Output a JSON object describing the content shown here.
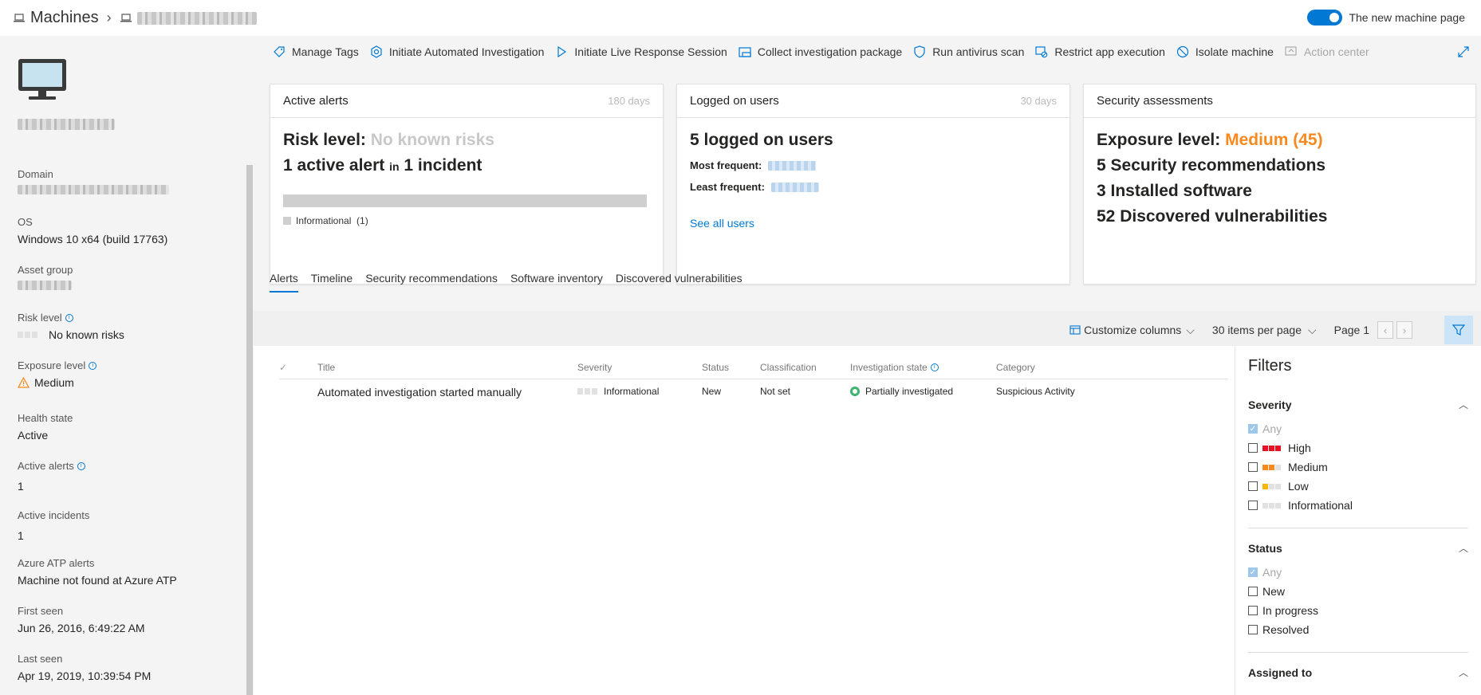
{
  "header": {
    "breadcrumb_root": "Machines",
    "toggle_label": "The new machine page"
  },
  "actions": [
    {
      "label": "Manage Tags",
      "icon": "tag-icon"
    },
    {
      "label": "Initiate Automated Investigation",
      "icon": "investigation-icon"
    },
    {
      "label": "Initiate Live Response Session",
      "icon": "play-icon"
    },
    {
      "label": "Collect investigation package",
      "icon": "package-icon"
    },
    {
      "label": "Run antivirus scan",
      "icon": "shield-icon"
    },
    {
      "label": "Restrict app execution",
      "icon": "restrict-icon"
    },
    {
      "label": "Isolate machine",
      "icon": "block-icon"
    },
    {
      "label": "Action center",
      "icon": "action-center-icon"
    }
  ],
  "sidebar": {
    "domain_label": "Domain",
    "os_label": "OS",
    "os_value": "Windows 10 x64 (build 17763)",
    "asset_group_label": "Asset group",
    "risk_label": "Risk level",
    "risk_value": "No known risks",
    "exposure_label": "Exposure level",
    "exposure_value": "Medium",
    "health_label": "Health state",
    "health_value": "Active",
    "alerts_label": "Active alerts",
    "alerts_value": "1",
    "incidents_label": "Active incidents",
    "incidents_value": "1",
    "atp_label": "Azure ATP alerts",
    "atp_value": "Machine not found at Azure ATP",
    "first_seen_label": "First seen",
    "first_seen_value": "Jun 26, 2016, 6:49:22 AM",
    "last_seen_label": "Last seen",
    "last_seen_value": "Apr 19, 2019, 10:39:54 PM"
  },
  "cards": {
    "alerts": {
      "title": "Active alerts",
      "days": "180 days",
      "risk_prefix": "Risk level: ",
      "risk_value": "No known risks",
      "alert_count": "1 active alert",
      "in_word": "in",
      "incident_count": "1 incident",
      "legend_label": "Informational",
      "legend_count": "(1)"
    },
    "users": {
      "title": "Logged on users",
      "days": "30 days",
      "count": "5 logged on users",
      "most_label": "Most frequent:",
      "least_label": "Least frequent:",
      "link": "See all users"
    },
    "security": {
      "title": "Security assessments",
      "exposure_prefix": "Exposure level: ",
      "exposure_value": "Medium (45)",
      "recommendations": "5 Security recommendations",
      "software": "3 Installed software",
      "vulnerabilities": "52 Discovered vulnerabilities"
    }
  },
  "tabs": [
    "Alerts",
    "Timeline",
    "Security recommendations",
    "Software inventory",
    "Discovered vulnerabilities"
  ],
  "toolbar": {
    "customize": "Customize columns",
    "per_page": "30 items per page",
    "page": "Page 1"
  },
  "table": {
    "headers": {
      "title": "Title",
      "severity": "Severity",
      "status": "Status",
      "classification": "Classification",
      "investigation": "Investigation state",
      "category": "Category"
    },
    "rows": [
      {
        "title": "Automated investigation started manually",
        "severity": "Informational",
        "status": "New",
        "classification": "Not set",
        "investigation": "Partially investigated",
        "category": "Suspicious Activity"
      }
    ]
  },
  "filters": {
    "title": "Filters",
    "severity_title": "Severity",
    "severity_options": [
      "Any",
      "High",
      "Medium",
      "Low",
      "Informational"
    ],
    "status_title": "Status",
    "status_options": [
      "Any",
      "New",
      "In progress",
      "Resolved"
    ],
    "assigned_title": "Assigned to"
  },
  "colors": {
    "accent": "#0078d4",
    "orange": "#f7891e",
    "high": "#e81123",
    "medium": "#f7891e",
    "low": "#f7b500"
  }
}
